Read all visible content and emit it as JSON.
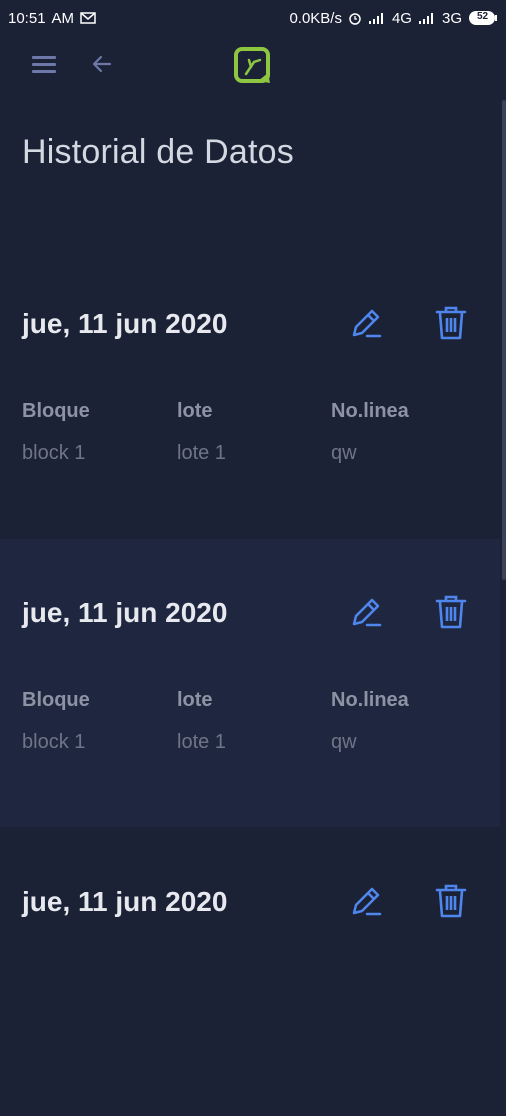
{
  "status_bar": {
    "time": "10:51",
    "ampm": "AM",
    "net_speed": "0.0KB/s",
    "sig1": "4G",
    "sig2": "3G",
    "battery": "52"
  },
  "header": {
    "title": "Historial de Datos"
  },
  "columns": {
    "block": "Bloque",
    "lot": "lote",
    "line": "No.linea"
  },
  "records": [
    {
      "date": "jue, 11 jun 2020",
      "block": "block 1",
      "lot": "lote 1",
      "line": "qw"
    },
    {
      "date": "jue, 11 jun 2020",
      "block": "block 1",
      "lot": "lote 1",
      "line": "qw"
    },
    {
      "date": "jue, 11 jun 2020",
      "block": "",
      "lot": "",
      "line": ""
    }
  ],
  "colors": {
    "background": "#1b2236",
    "card_alt": "#1f2740",
    "accent_icon": "#4f86ee",
    "logo_green": "#8ec641"
  },
  "icons": [
    "menu-icon",
    "back-icon",
    "logo-icon",
    "edit-icon",
    "trash-icon"
  ]
}
